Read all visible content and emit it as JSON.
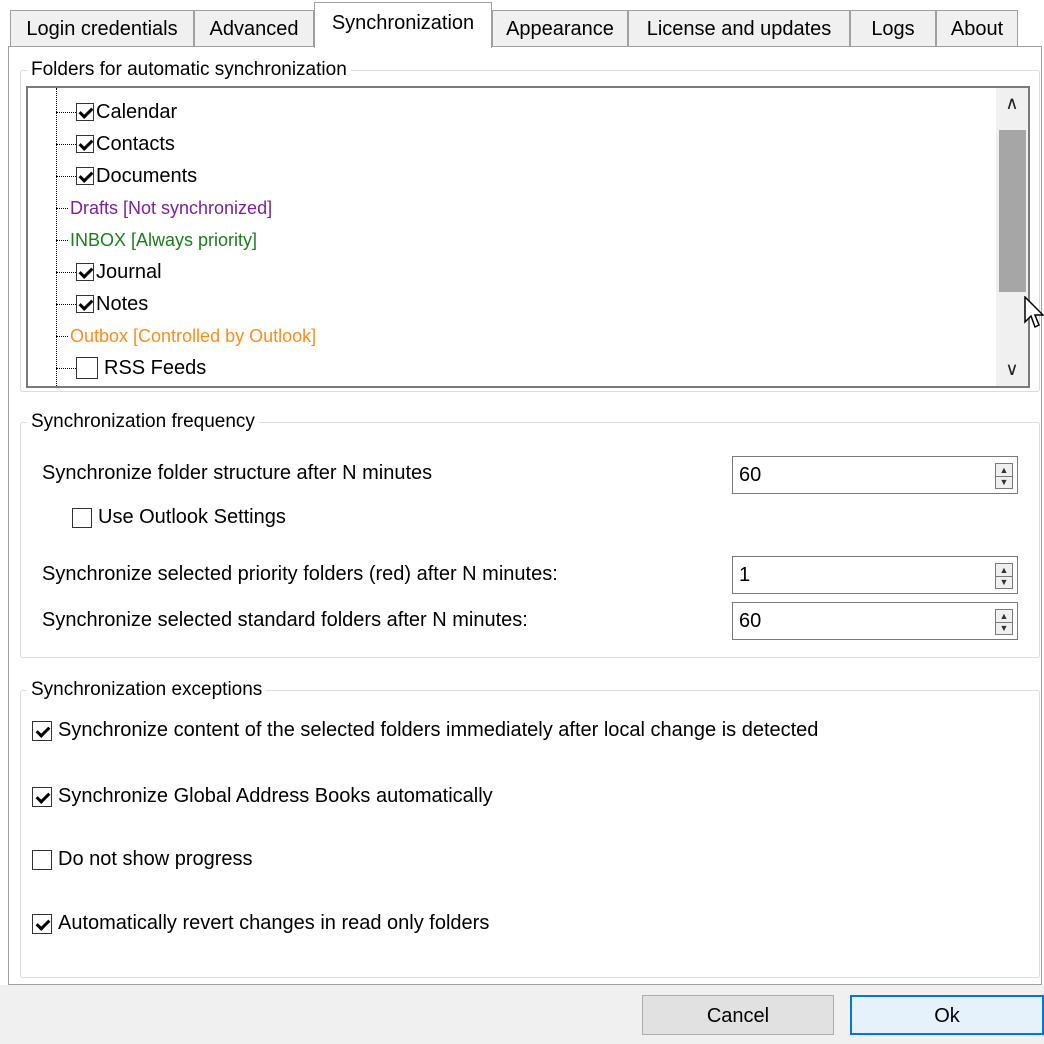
{
  "tabs": [
    {
      "label": "Login credentials"
    },
    {
      "label": "Advanced"
    },
    {
      "label": "Synchronization",
      "active": true
    },
    {
      "label": "Appearance"
    },
    {
      "label": "License and updates"
    },
    {
      "label": "Logs"
    },
    {
      "label": "About"
    }
  ],
  "folders": {
    "legend": "Folders for automatic synchronization",
    "items": [
      {
        "label": "Calendar",
        "checked": true
      },
      {
        "label": "Contacts",
        "checked": true
      },
      {
        "label": "Documents",
        "checked": true
      },
      {
        "label": "Drafts [Not synchronized]",
        "color": "#7f1f9f"
      },
      {
        "label": "INBOX [Always priority]",
        "color": "#1a7f1a"
      },
      {
        "label": "Journal",
        "checked": true
      },
      {
        "label": "Notes",
        "checked": true
      },
      {
        "label": "Outbox [Controlled by Outlook]",
        "color": "#ff8c1a"
      },
      {
        "label": "RSS Feeds",
        "checked": false
      }
    ],
    "scroll_up_icon": "chevron-up",
    "scroll_down_icon": "chevron-down"
  },
  "frequency": {
    "legend": "Synchronization frequency",
    "structure_label": "Synchronize folder structure after N minutes",
    "structure_value": "60",
    "use_outlook_label": "Use Outlook Settings",
    "use_outlook_checked": false,
    "priority_label": "Synchronize selected priority folders (red) after N minutes:",
    "priority_value": "1",
    "standard_label": "Synchronize selected standard folders after N minutes:",
    "standard_value": "60"
  },
  "exceptions": {
    "legend": "Synchronization exceptions",
    "items": [
      {
        "label": "Synchronize content of the selected folders immediately after local change is detected",
        "checked": true
      },
      {
        "label": "Synchronize Global Address Books automatically",
        "checked": true
      },
      {
        "label": "Do not show progress",
        "checked": false
      },
      {
        "label": "Automatically revert changes in read only folders",
        "checked": true
      }
    ]
  },
  "buttons": {
    "cancel": "Cancel",
    "ok": "Ok"
  },
  "colors": {
    "accent": "#0078d7",
    "drafts": "#7f1f9f",
    "inbox": "#1a7f1a",
    "outbox": "#ff8c1a"
  }
}
